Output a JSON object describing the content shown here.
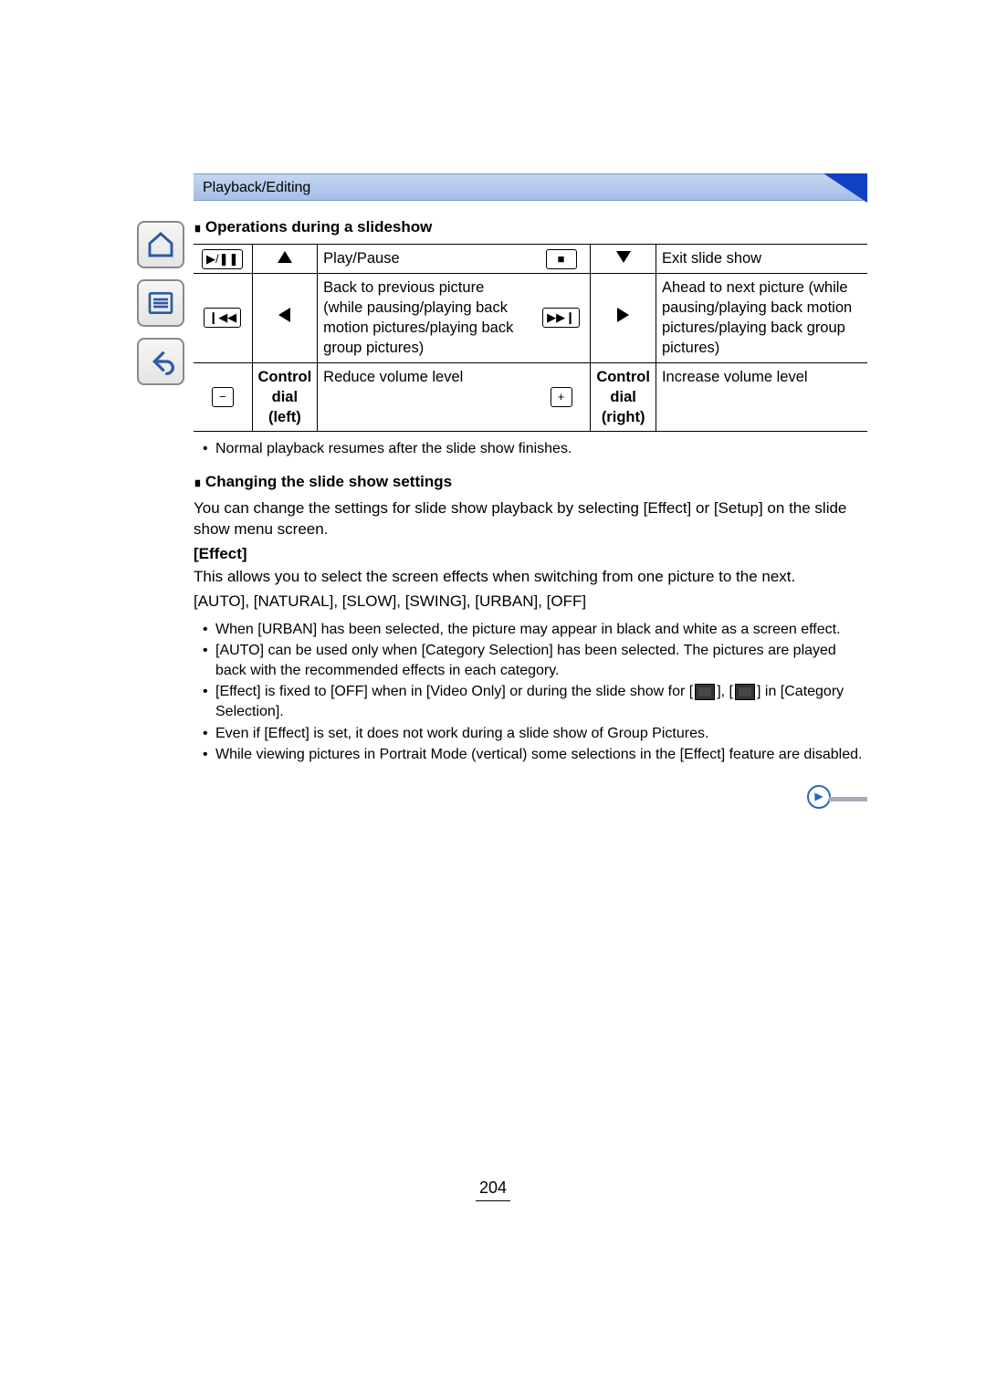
{
  "breadcrumb": "Playback/Editing",
  "sections": {
    "ops_head": "Operations during a slideshow",
    "settings_head": "Changing the slide show settings",
    "effect_head": "[Effect]"
  },
  "table": {
    "r1c1_desc": "Play/Pause",
    "r1c2_desc": "Exit slide show",
    "r2c1_desc": "Back to previous picture (while pausing/playing back motion pictures/playing back group pictures)",
    "r2c2_desc": "Ahead to next picture (while pausing/playing back motion pictures/playing back group pictures)",
    "r3c1_ctrl_l1": "Control",
    "r3c1_ctrl_l2": "dial",
    "r3c1_ctrl_l3": "(left)",
    "r3c1_desc": "Reduce volume level",
    "r3c2_ctrl_l1": "Control",
    "r3c2_ctrl_l2": "dial",
    "r3c2_ctrl_l3": "(right)",
    "r3c2_desc": "Increase volume level"
  },
  "icons": {
    "play_pause": "▶/❚❚",
    "stop": "■",
    "skip_back": "❙◀◀",
    "skip_fwd": "▶▶❙",
    "minus": "−",
    "plus": "+"
  },
  "note_after_table": "Normal playback resumes after the slide show finishes.",
  "settings_intro": "You can change the settings for slide show playback by selecting [Effect] or [Setup] on the slide show menu screen.",
  "effect_intro": "This allows you to select the screen effects when switching from one picture to the next.",
  "effect_options": "[AUTO], [NATURAL], [SLOW], [SWING], [URBAN], [OFF]",
  "effect_notes": {
    "n1": "When [URBAN] has been selected, the picture may appear in black and white as a screen effect.",
    "n2": "[AUTO] can be used only when [Category Selection] has been selected. The pictures are played back with the recommended effects in each category.",
    "n3_pre": "[Effect] is fixed to [OFF] when in [Video Only] or during the slide show for [",
    "n3_mid": "], [",
    "n3_post": "] in [Category Selection].",
    "n4": "Even if [Effect] is set, it does not work during a slide show of Group Pictures.",
    "n5": "While viewing pictures in Portrait Mode (vertical) some selections in the [Effect] feature are disabled."
  },
  "page_number": "204"
}
